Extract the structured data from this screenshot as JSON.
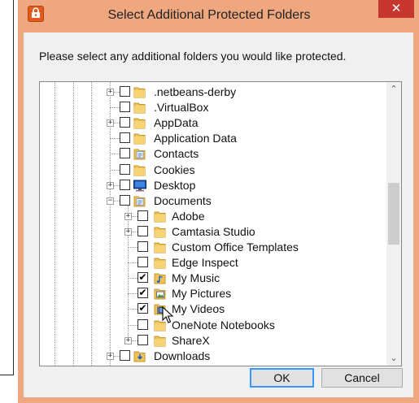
{
  "window": {
    "title": "Select Additional Protected Folders",
    "close_glyph": "✕",
    "app_icon": "lock-app-icon"
  },
  "instruction": "Please select any additional folders you would like protected.",
  "tree": {
    "items": [
      {
        "label": ".netbeans-derby",
        "level": 1,
        "expander": "+",
        "checked": false,
        "icon": "folder-icon"
      },
      {
        "label": ".VirtualBox",
        "level": 1,
        "expander": "",
        "checked": false,
        "icon": "folder-icon"
      },
      {
        "label": "AppData",
        "level": 1,
        "expander": "+",
        "checked": false,
        "icon": "folder-icon"
      },
      {
        "label": "Application Data",
        "level": 1,
        "expander": "",
        "checked": false,
        "icon": "folder-icon"
      },
      {
        "label": "Contacts",
        "level": 1,
        "expander": "",
        "checked": false,
        "icon": "contacts-icon"
      },
      {
        "label": "Cookies",
        "level": 1,
        "expander": "",
        "checked": false,
        "icon": "folder-icon"
      },
      {
        "label": "Desktop",
        "level": 1,
        "expander": "+",
        "checked": false,
        "icon": "desktop-icon"
      },
      {
        "label": "Documents",
        "level": 1,
        "expander": "−",
        "checked": false,
        "icon": "documents-icon"
      },
      {
        "label": "Adobe",
        "level": 2,
        "expander": "+",
        "checked": false,
        "icon": "folder-icon"
      },
      {
        "label": "Camtasia Studio",
        "level": 2,
        "expander": "+",
        "checked": false,
        "icon": "folder-icon"
      },
      {
        "label": "Custom Office Templates",
        "level": 2,
        "expander": "",
        "checked": false,
        "icon": "folder-icon"
      },
      {
        "label": "Edge Inspect",
        "level": 2,
        "expander": "",
        "checked": false,
        "icon": "folder-icon"
      },
      {
        "label": "My Music",
        "level": 2,
        "expander": "",
        "checked": true,
        "icon": "music-icon"
      },
      {
        "label": "My Pictures",
        "level": 2,
        "expander": "",
        "checked": true,
        "icon": "pictures-icon"
      },
      {
        "label": "My Videos",
        "level": 2,
        "expander": "",
        "checked": true,
        "icon": "videos-icon"
      },
      {
        "label": "OneNote Notebooks",
        "level": 2,
        "expander": "",
        "checked": false,
        "icon": "folder-icon"
      },
      {
        "label": "ShareX",
        "level": 2,
        "expander": "+",
        "checked": false,
        "icon": "folder-icon"
      },
      {
        "label": "Downloads",
        "level": 1,
        "expander": "+",
        "checked": false,
        "icon": "downloads-icon"
      }
    ],
    "check_glyph": "✔"
  },
  "scrollbar": {
    "up_glyph": "⌃",
    "down_glyph": "⌄"
  },
  "buttons": {
    "ok": "OK",
    "cancel": "Cancel"
  },
  "colors": {
    "frame": "#eea77f",
    "close": "#c7372f",
    "folder": "#e9b83b"
  }
}
